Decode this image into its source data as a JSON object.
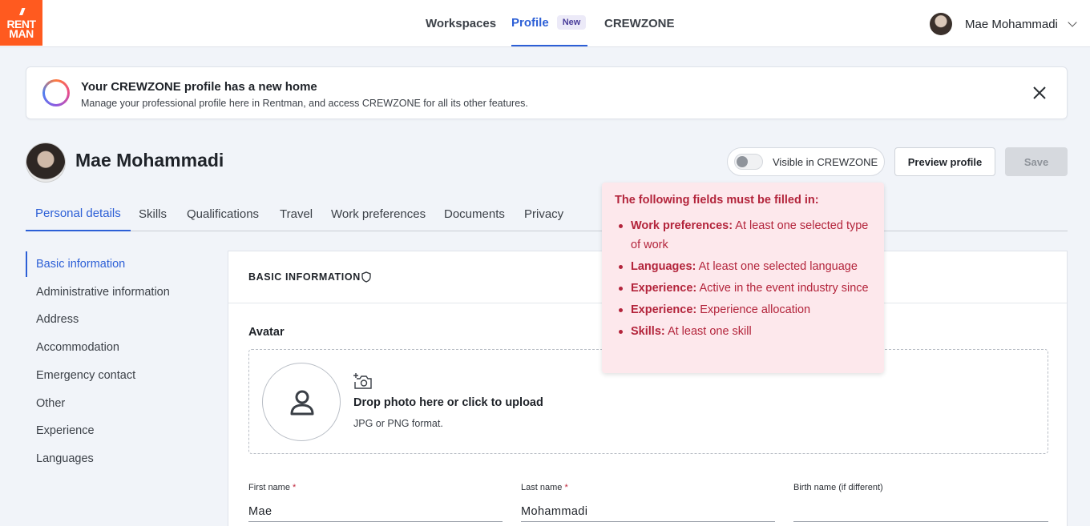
{
  "logo": {
    "line1": "RENT",
    "line2": "MAN",
    "marks": "///"
  },
  "nav": {
    "items": [
      {
        "label": "Workspaces"
      },
      {
        "label": "Profile",
        "badge": "New"
      },
      {
        "label": "CREWZONE"
      }
    ],
    "active": "Profile"
  },
  "user": {
    "name": "Mae Mohammadi"
  },
  "banner": {
    "title": "Your CREWZONE profile has a new home",
    "text": "Manage your professional profile here in Rentman, and access CREWZONE for all its other features."
  },
  "profile": {
    "name": "Mae Mohammadi",
    "visible_label": "Visible in CREWZONE",
    "visible": false,
    "preview_label": "Preview profile",
    "save_label": "Save"
  },
  "tabs": [
    "Personal details",
    "Skills",
    "Qualifications",
    "Travel",
    "Work preferences",
    "Documents",
    "Privacy"
  ],
  "side_menu": [
    "Basic information",
    "Administrative information",
    "Address",
    "Accommodation",
    "Emergency contact",
    "Other",
    "Experience",
    "Languages"
  ],
  "section": {
    "title": "BASIC INFORMATION",
    "avatar_label": "Avatar",
    "dropzone_title": "Drop photo here or click to upload",
    "dropzone_sub": "JPG or PNG format."
  },
  "fields": {
    "first_name": {
      "label": "First name",
      "required": "*",
      "value": "Mae"
    },
    "last_name": {
      "label": "Last name",
      "required": "*",
      "value": "Mohammadi"
    },
    "birth_name": {
      "label": "Birth name (if different)",
      "value": ""
    }
  },
  "validation": {
    "title": "The following fields must be filled in:",
    "items": [
      {
        "key": "Work preferences:",
        "text": "At least one selected type of work"
      },
      {
        "key": "Languages:",
        "text": "At least one selected language"
      },
      {
        "key": "Experience:",
        "text": "Active in the event industry since"
      },
      {
        "key": "Experience:",
        "text": "Experience allocation"
      },
      {
        "key": "Skills:",
        "text": "At least one skill"
      }
    ]
  },
  "colors": {
    "accent": "#2c5fd6",
    "brand": "#ff5a1f",
    "error": "#b3243b",
    "error_bg": "#fde8ec"
  }
}
